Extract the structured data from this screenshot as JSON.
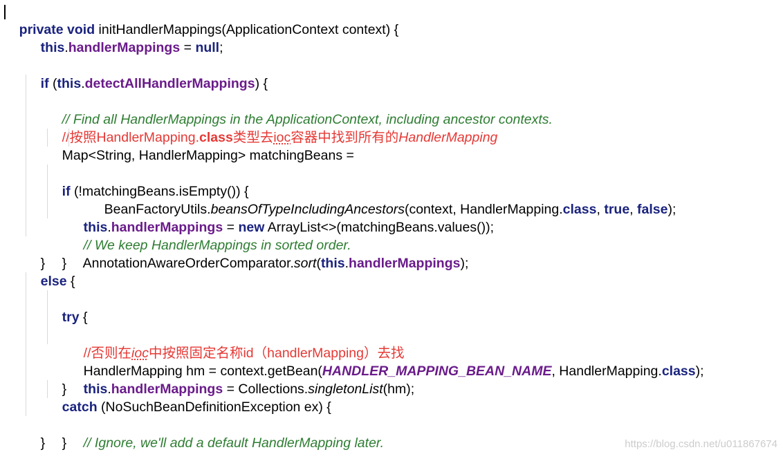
{
  "code": {
    "line01": {
      "kw_private": "private",
      "sp1": " ",
      "kw_void": "void",
      "rest": " initHandlerMappings(ApplicationContext context) {"
    },
    "line02": {
      "kw_this": "this",
      "dot": ".",
      "field": "handlerMappings",
      "eq": " = ",
      "kw_null": "null",
      "semi": ";"
    },
    "line04": {
      "kw_if": "if",
      "open": " (",
      "kw_this": "this",
      "dot": ".",
      "field": "detectAllHandlerMappings",
      "close": ") {"
    },
    "line05": {
      "comment": "// Find all HandlerMappings in the ApplicationContext, including ancestor contexts."
    },
    "line06": {
      "prefix": "//按照HandlerMapping.",
      "kw_class": "class",
      "mid1": "类型去",
      "ioc": "ioc",
      "mid2": "容器中找到所有的",
      "italic": "HandlerMapping"
    },
    "line07": {
      "text": "Map<String, HandlerMapping> matchingBeans ="
    },
    "line08": {
      "pre": "BeanFactoryUtils.",
      "method": "beansOfTypeIncludingAncestors",
      "mid": "(context, HandlerMapping.",
      "kw_class": "class",
      "c1": ", ",
      "kw_true": "true",
      "c2": ", ",
      "kw_false": "false",
      "end": ");"
    },
    "line09": {
      "kw_if": "if",
      "rest": " (!matchingBeans.isEmpty()) {"
    },
    "line10": {
      "kw_this": "this",
      "dot": ".",
      "field": "handlerMappings",
      "eq": " = ",
      "kw_new": "new",
      "rest": " ArrayList<>(matchingBeans.values());"
    },
    "line11": {
      "comment": "// We keep HandlerMappings in sorted order."
    },
    "line12": {
      "pre": "AnnotationAwareOrderComparator.",
      "method": "sort",
      "open": "(",
      "kw_this": "this",
      "dot": ".",
      "field": "handlerMappings",
      "end": ");"
    },
    "line13": {
      "text": "}"
    },
    "line14": {
      "text": "}"
    },
    "line15": {
      "kw_else": "else",
      "rest": " {"
    },
    "line16": {
      "kw_try": "try",
      "rest": " {"
    },
    "line17": {
      "prefix": "//否则在",
      "ioc": "ioc",
      "rest": "中按照固定名称id（handlerMapping）去找"
    },
    "line18": {
      "pre": "HandlerMapping hm = context.getBean(",
      "const": "HANDLER_MAPPING_BEAN_NAME",
      "mid": ", HandlerMapping.",
      "kw_class": "class",
      "end": ");"
    },
    "line19": {
      "kw_this": "this",
      "dot": ".",
      "field": "handlerMappings",
      "mid": " = Collections.",
      "method": "singletonList",
      "end": "(hm);"
    },
    "line20": {
      "text": "}"
    },
    "line21": {
      "kw_catch": "catch",
      "rest": " (NoSuchBeanDefinitionException ex) {"
    },
    "line22": {
      "comment": "// Ignore, we'll add a default HandlerMapping later."
    },
    "line23": {
      "text": "}"
    },
    "line24": {
      "text": "}"
    }
  },
  "watermark": "https://blog.csdn.net/u011867674",
  "colors": {
    "keyword": "#1a237e",
    "field": "#6a1b8a",
    "comment": "#2e7d32",
    "annotation_red": "#e53935",
    "indent_guide": "#d8d8d8"
  }
}
